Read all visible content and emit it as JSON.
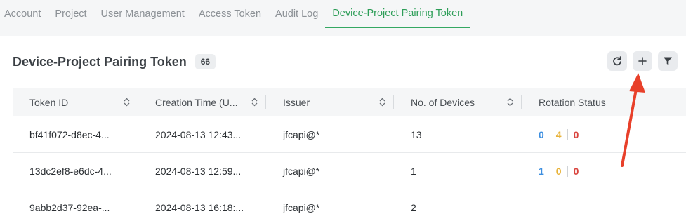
{
  "tabs": [
    "Account",
    "Project",
    "User Management",
    "Access Token",
    "Audit Log",
    "Device-Project Pairing Token"
  ],
  "active_tab_index": 5,
  "page": {
    "title": "Device-Project Pairing Token",
    "count": "66"
  },
  "toolbar": {
    "refresh_icon": "refresh-icon",
    "add_icon": "plus-icon",
    "filter_icon": "filter-icon"
  },
  "table": {
    "headers": [
      "Token ID",
      "Creation Time (U...",
      "Issuer",
      "No. of Devices",
      "Rotation Status"
    ],
    "rows": [
      {
        "token_id": "bf41f072-d8ec-4...",
        "created": "2024-08-13 12:43...",
        "issuer": "jfcapi@*",
        "devices": "13",
        "rotation": [
          "0",
          "4",
          "0"
        ]
      },
      {
        "token_id": "13dc2ef8-e6dc-4...",
        "created": "2024-08-13 12:59...",
        "issuer": "jfcapi@*",
        "devices": "1",
        "rotation": [
          "1",
          "0",
          "0"
        ]
      },
      {
        "token_id": "9abb2d37-92ea-...",
        "created": "2024-08-13 16:18:...",
        "issuer": "jfcapi@*",
        "devices": "2",
        "rotation": []
      }
    ]
  },
  "colors": {
    "accent": "#34a862",
    "rotation_blue": "#3d8fe0",
    "rotation_yellow": "#e8b33a",
    "rotation_red": "#d9443e",
    "annotation_arrow": "#e8402a"
  }
}
